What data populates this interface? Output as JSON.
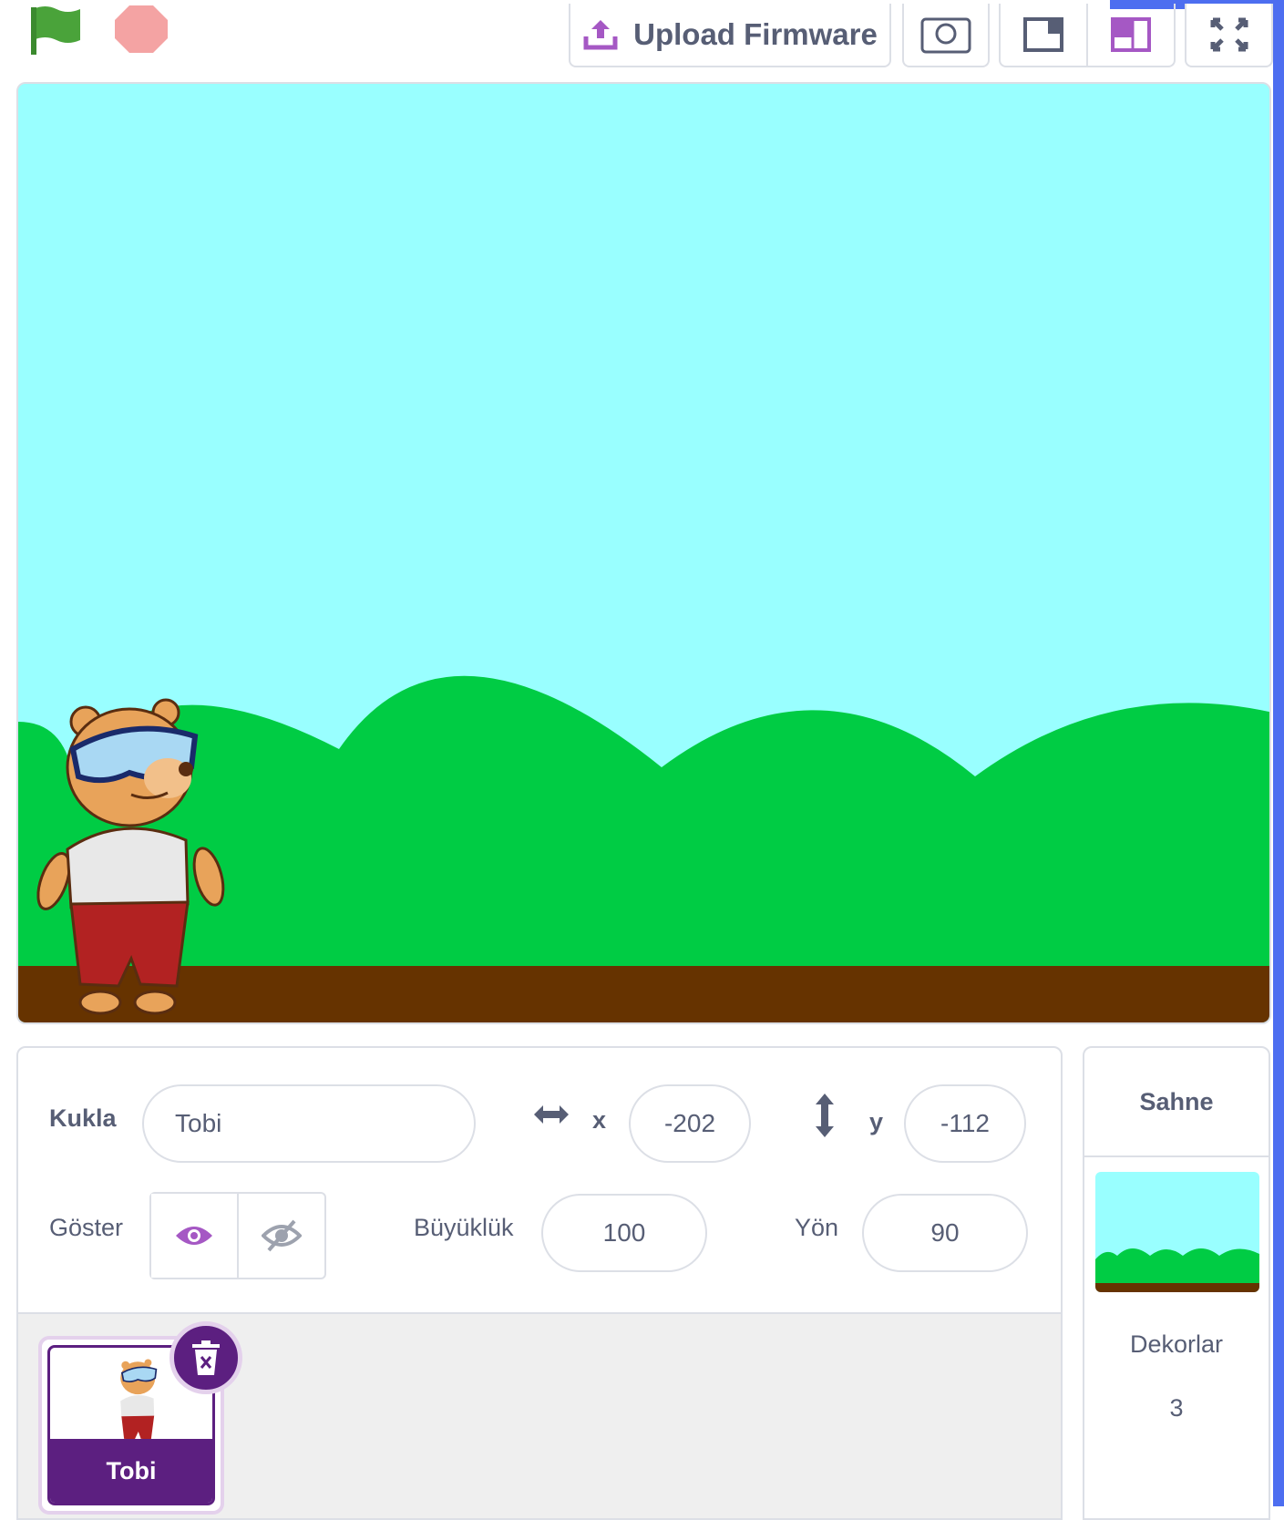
{
  "toolbar": {
    "green_flag_icon": "green-flag-icon",
    "stop_icon": "stop-sign-icon",
    "upload_label": "Upload Firmware",
    "upload_icon": "upload-icon",
    "screenshot_icon": "camera-icon",
    "small_stage_icon": "small-stage-layout-icon",
    "large_stage_icon": "large-stage-layout-icon",
    "fullscreen_icon": "fullscreen-icon"
  },
  "stage": {
    "sky_color": "#99ffff",
    "hills_color": "#00cc44",
    "ground_color": "#663300",
    "sprite_name": "Tobi"
  },
  "sprite_info": {
    "sprite_label": "Kukla",
    "sprite_name": "Tobi",
    "x_label": "x",
    "x_value": "-202",
    "y_label": "y",
    "y_value": "-112",
    "show_label": "Göster",
    "size_label": "Büyüklük",
    "size_value": "100",
    "direction_label": "Yön",
    "direction_value": "90"
  },
  "sprite_list": {
    "items": [
      {
        "name": "Tobi",
        "selected": true
      }
    ]
  },
  "stage_panel": {
    "title": "Sahne",
    "backdrops_label": "Dekorlar",
    "backdrops_count": "3"
  },
  "colors": {
    "accent_purple": "#5c1f80",
    "panel_border": "#dcdfe6",
    "text": "#575e75",
    "edge_blue": "#4d6ef0"
  }
}
